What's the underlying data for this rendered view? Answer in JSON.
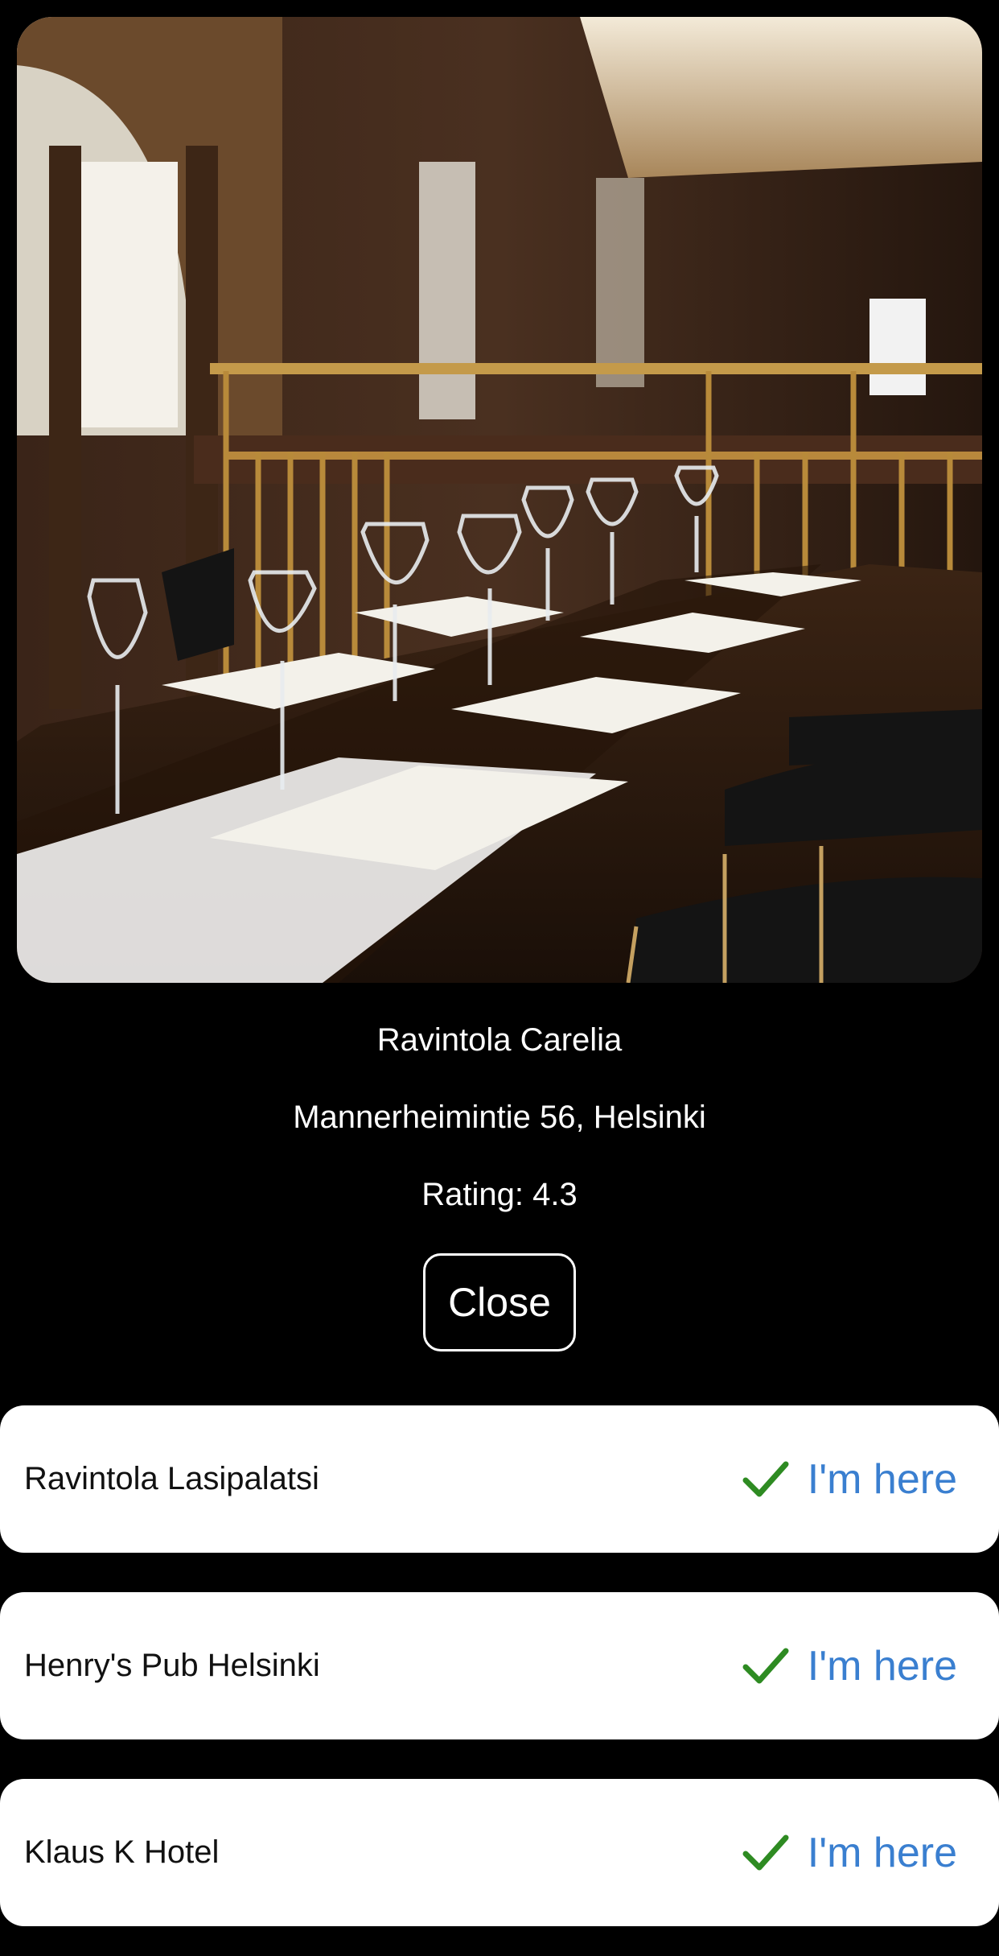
{
  "selected_place": {
    "name": "Ravintola Carelia",
    "address": "Mannerheimintie 56, Helsinki",
    "rating_text": "Rating: 4.3",
    "close_label": "Close",
    "photo_subject": "restaurant-interior-table-setting"
  },
  "places": [
    {
      "name": "Ravintola Lasipalatsi",
      "action_label": "I'm here",
      "action_icon": "checkmark-icon"
    },
    {
      "name": "Henry's Pub Helsinki",
      "action_label": "I'm here",
      "action_icon": "checkmark-icon"
    },
    {
      "name": "Klaus K Hotel",
      "action_label": "I'm here",
      "action_icon": "checkmark-icon"
    }
  ],
  "colors": {
    "background": "#000000",
    "card": "#ffffff",
    "accent": "#3a7fd0",
    "check": "#2e8b22"
  }
}
